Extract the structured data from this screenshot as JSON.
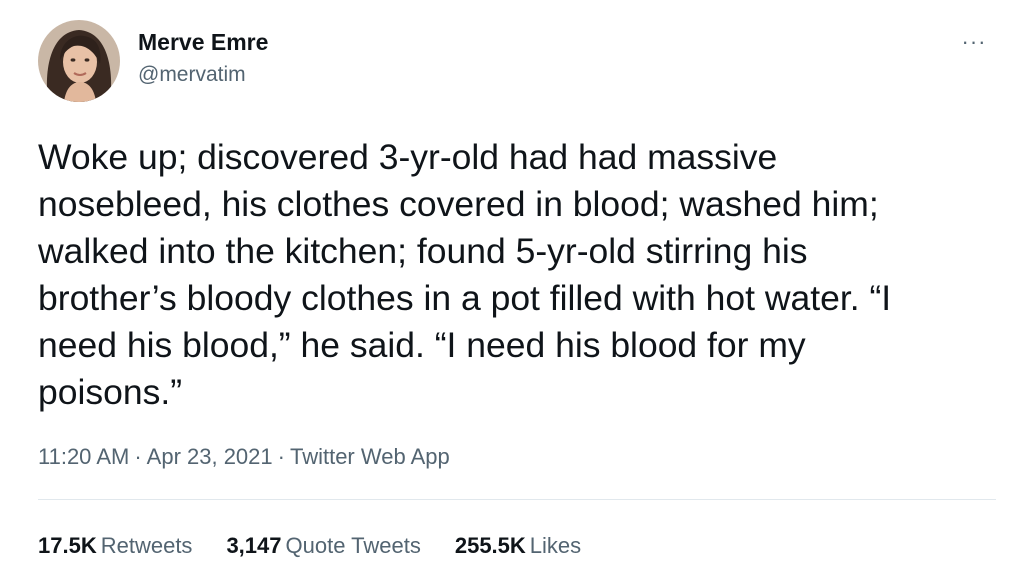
{
  "user": {
    "display_name": "Merve Emre",
    "handle": "@mervatim",
    "avatar": "profile-photo"
  },
  "menu": {
    "icon": "more-horizontal-icon",
    "label": "···"
  },
  "tweet": {
    "lines": [
      "Woke up; discovered 3-yr-old had had massive",
      "nosebleed, his clothes covered in blood; washed him;",
      "walked into the kitchen; found 5-yr-old stirring his",
      "brother’s bloody clothes in a pot filled with hot water. “I",
      "need his blood,” he said. “I need his blood for my",
      "poisons.”"
    ]
  },
  "meta": {
    "time": "11:20 AM",
    "separator": "·",
    "date": "Apr 23, 2021",
    "source": "Twitter Web App"
  },
  "stats": {
    "retweets_count": "17.5K",
    "retweets_label": "Retweets",
    "quotes_count": "3,147",
    "quotes_label": "Quote Tweets",
    "likes_count": "255.5K",
    "likes_label": "Likes"
  },
  "colors": {
    "text": "#0f1419",
    "secondary": "#536471",
    "divider": "#e1e8ed"
  }
}
